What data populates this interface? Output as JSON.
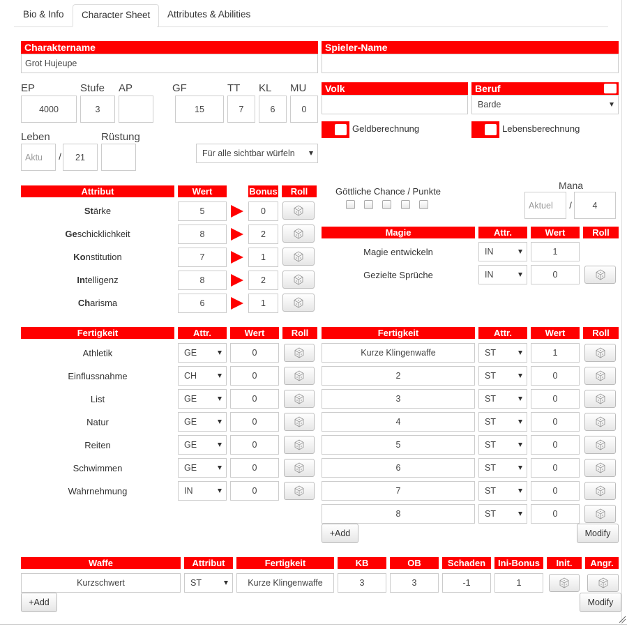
{
  "tabs": [
    "Bio & Info",
    "Character Sheet",
    "Attributes & Abilities"
  ],
  "header": {
    "char_label": "Charaktername",
    "char_value": "Grot Hujeupe",
    "player_label": "Spieler-Name",
    "player_value": ""
  },
  "stats": {
    "ep_label": "EP",
    "ep": "4000",
    "stufe_label": "Stufe",
    "stufe": "3",
    "ap_label": "AP",
    "ap": "",
    "gf_label": "GF",
    "gf": "15",
    "tt_label": "TT",
    "tt": "7",
    "kl_label": "KL",
    "kl": "6",
    "mu_label": "MU",
    "mu": "0",
    "leben_label": "Leben",
    "leben_current_placeholder": "Aktu",
    "leben_max": "21",
    "leben_sep": "/",
    "ruestung_label": "Rüstung",
    "ruestung": "",
    "roll_visibility": "Für alle sichtbar würfeln"
  },
  "volk_label": "Volk",
  "volk": "",
  "beruf_label": "Beruf",
  "beruf": "Barde",
  "geld_label": "Geldberechnung",
  "lebensber_label": "Lebensberechnung",
  "attributes": {
    "header": [
      "Attribut",
      "Wert",
      "Bonus",
      "Roll"
    ],
    "rows": [
      {
        "bold": "St",
        "rest": "ärke",
        "wert": "5",
        "bonus": "0"
      },
      {
        "bold": "Ge",
        "rest": "schicklichkeit",
        "wert": "8",
        "bonus": "2"
      },
      {
        "bold": "Ko",
        "rest": "nstitution",
        "wert": "7",
        "bonus": "1"
      },
      {
        "bold": "In",
        "rest": "telligenz",
        "wert": "8",
        "bonus": "2"
      },
      {
        "bold": "Ch",
        "rest": "arisma",
        "wert": "6",
        "bonus": "1"
      }
    ]
  },
  "divine": {
    "label": "Göttliche Chance / Punkte"
  },
  "mana": {
    "label": "Mana",
    "current_placeholder": "Aktuel",
    "sep": "/",
    "max": "4"
  },
  "magie": {
    "header": [
      "Magie",
      "Attr.",
      "Wert",
      "Roll"
    ],
    "rows": [
      {
        "name": "Magie entwickeln",
        "attr": "IN",
        "wert": "1"
      },
      {
        "name": "Gezielte Sprüche",
        "attr": "IN",
        "wert": "0"
      }
    ]
  },
  "skills_left": {
    "header": [
      "Fertigkeit",
      "Attr.",
      "Wert",
      "Roll"
    ],
    "rows": [
      {
        "name": "Athletik",
        "attr": "GE",
        "wert": "0"
      },
      {
        "name": "Einflussnahme",
        "attr": "CH",
        "wert": "0"
      },
      {
        "name": "List",
        "attr": "GE",
        "wert": "0"
      },
      {
        "name": "Natur",
        "attr": "GE",
        "wert": "0"
      },
      {
        "name": "Reiten",
        "attr": "GE",
        "wert": "0"
      },
      {
        "name": "Schwimmen",
        "attr": "GE",
        "wert": "0"
      },
      {
        "name": "Wahrnehmung",
        "attr": "IN",
        "wert": "0"
      }
    ]
  },
  "skills_right": {
    "header": [
      "Fertigkeit",
      "Attr.",
      "Wert",
      "Roll"
    ],
    "rows": [
      {
        "name": "Kurze Klingenwaffe",
        "attr": "ST",
        "wert": "1"
      },
      {
        "name": "2",
        "attr": "ST",
        "wert": "0"
      },
      {
        "name": "3",
        "attr": "ST",
        "wert": "0"
      },
      {
        "name": "4",
        "attr": "ST",
        "wert": "0"
      },
      {
        "name": "5",
        "attr": "ST",
        "wert": "0"
      },
      {
        "name": "6",
        "attr": "ST",
        "wert": "0"
      },
      {
        "name": "7",
        "attr": "ST",
        "wert": "0"
      },
      {
        "name": "8",
        "attr": "ST",
        "wert": "0"
      }
    ]
  },
  "weapons": {
    "header": [
      "Waffe",
      "Attribut",
      "Fertigkeit",
      "KB",
      "OB",
      "Schaden",
      "Ini-Bonus",
      "Init.",
      "Angr."
    ],
    "rows": [
      {
        "name": "Kurzschwert",
        "attr": "ST",
        "skill": "Kurze Klingenwaffe",
        "kb": "3",
        "ob": "3",
        "schaden": "-1",
        "ini": "1"
      }
    ]
  },
  "buttons": {
    "add": "+Add",
    "modify": "Modify"
  },
  "colors": {
    "accent": "#ff0000"
  }
}
